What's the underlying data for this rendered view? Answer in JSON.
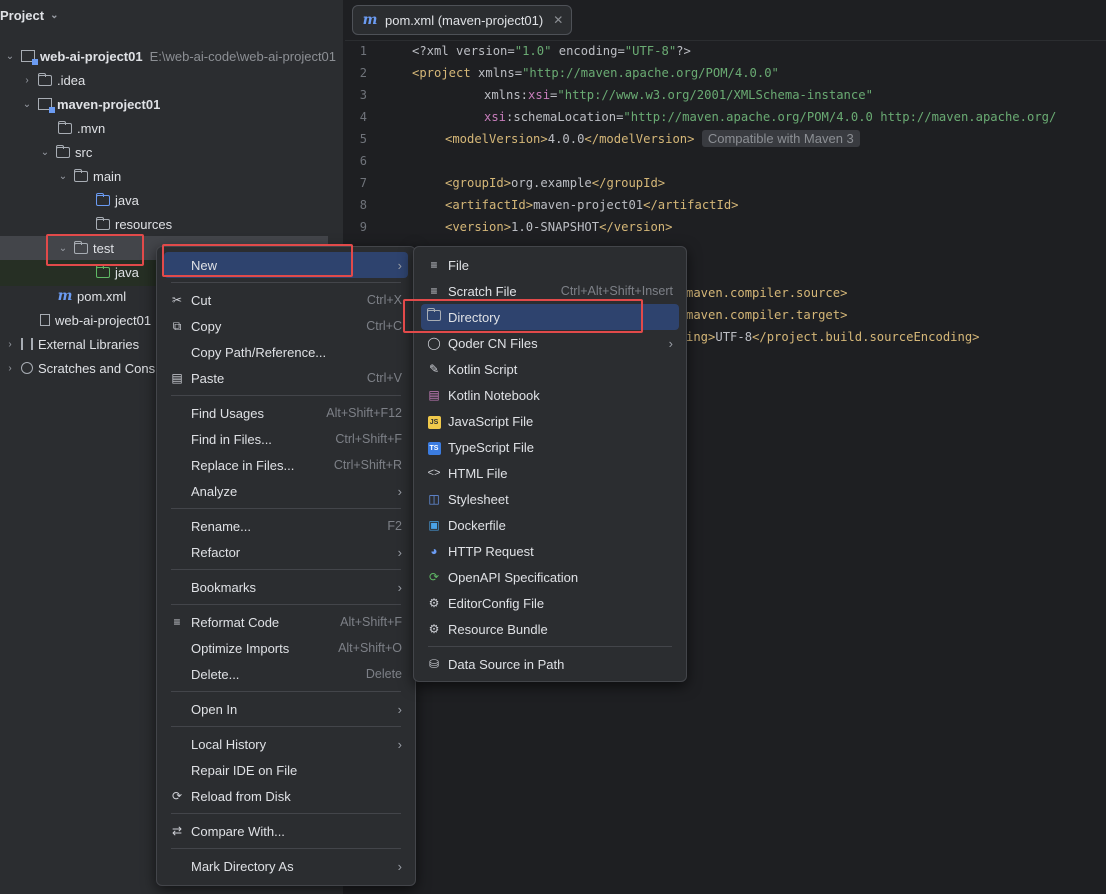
{
  "project_panel": {
    "title": "Project",
    "root": {
      "name": "web-ai-project01",
      "path": "E:\\web-ai-code\\web-ai-project01"
    },
    "items": [
      {
        "label": ".idea"
      },
      {
        "label": "maven-project01"
      },
      {
        "label": ".mvn"
      },
      {
        "label": "src"
      },
      {
        "label": "main"
      },
      {
        "label": "java"
      },
      {
        "label": "resources"
      },
      {
        "label": "test"
      },
      {
        "label": "java"
      },
      {
        "label": "pom.xml"
      },
      {
        "label": "web-ai-project01"
      },
      {
        "label": "External Libraries"
      },
      {
        "label": "Scratches and Cons"
      }
    ]
  },
  "editor": {
    "tab_label": "pom.xml (maven-project01)",
    "line_numbers": [
      "1",
      "2",
      "3",
      "4",
      "5",
      "6",
      "7",
      "8",
      "9"
    ],
    "hint": "Compatible with Maven 3",
    "code": {
      "l1a": "<?xml version=",
      "l1b": "\"1.0\"",
      "l1c": " encoding=",
      "l1d": "\"UTF-8\"",
      "l1e": "?>",
      "l2a": "<project",
      "l2b": " xmlns=",
      "l2c": "\"http://maven.apache.org/POM/4.0.0\"",
      "l3a": "xmlns:",
      "l3b": "xsi",
      "l3c": "=",
      "l3d": "\"http://www.w3.org/2001/XMLSchema-instance\"",
      "l4a": "xsi",
      "l4b": ":schemaLocation=",
      "l4c": "\"http://maven.apache.org/POM/4.0.0 http://maven.apache.org/",
      "l5a": "<modelVersion>",
      "l5b": "4.0.0",
      "l5c": "</modelVersion>",
      "l7a": "<groupId>",
      "l7b": "org.example",
      "l7c": "</groupId>",
      "l8a": "<artifactId>",
      "l8b": "maven-project01",
      "l8c": "</artifactId>",
      "l9a": "<version>",
      "l9b": "1.0-SNAPSHOT",
      "l9c": "</version>",
      "frag1": "maven.compiler.source>",
      "frag2": "maven.compiler.target>",
      "frag3a": "ing>",
      "frag3b": "UTF-8",
      "frag3c": "</project.build.sourceEncoding>"
    }
  },
  "context_menu": {
    "new": "New",
    "cut": "Cut",
    "cut_sc": "Ctrl+X",
    "copy": "Copy",
    "copy_sc": "Ctrl+C",
    "copy_path": "Copy Path/Reference...",
    "paste": "Paste",
    "paste_sc": "Ctrl+V",
    "find_usages": "Find Usages",
    "find_usages_sc": "Alt+Shift+F12",
    "find_in_files": "Find in Files...",
    "find_in_files_sc": "Ctrl+Shift+F",
    "replace_in_files": "Replace in Files...",
    "replace_in_files_sc": "Ctrl+Shift+R",
    "analyze": "Analyze",
    "rename": "Rename...",
    "rename_sc": "F2",
    "refactor": "Refactor",
    "bookmarks": "Bookmarks",
    "reformat": "Reformat Code",
    "reformat_sc": "Alt+Shift+F",
    "optimize": "Optimize Imports",
    "optimize_sc": "Alt+Shift+O",
    "delete": "Delete...",
    "delete_sc": "Delete",
    "open_in": "Open In",
    "local_history": "Local History",
    "repair": "Repair IDE on File",
    "reload": "Reload from Disk",
    "compare": "Compare With...",
    "mark_dir": "Mark Directory As"
  },
  "submenu": {
    "file": "File",
    "scratch": "Scratch File",
    "scratch_sc": "Ctrl+Alt+Shift+Insert",
    "directory": "Directory",
    "qoder": "Qoder CN Files",
    "kotlin_script": "Kotlin Script",
    "kotlin_notebook": "Kotlin Notebook",
    "js": "JavaScript File",
    "js_badge": "JS",
    "ts": "TypeScript File",
    "ts_badge": "TS",
    "html": "HTML File",
    "css": "Stylesheet",
    "docker": "Dockerfile",
    "http": "HTTP Request",
    "openapi": "OpenAPI Specification",
    "editorconfig": "EditorConfig File",
    "resource_bundle": "Resource Bundle",
    "datasource": "Data Source in Path"
  },
  "colors": {
    "highlight": "#e24a4a",
    "selection": "#2e436e",
    "accent": "#6b9bf2"
  }
}
